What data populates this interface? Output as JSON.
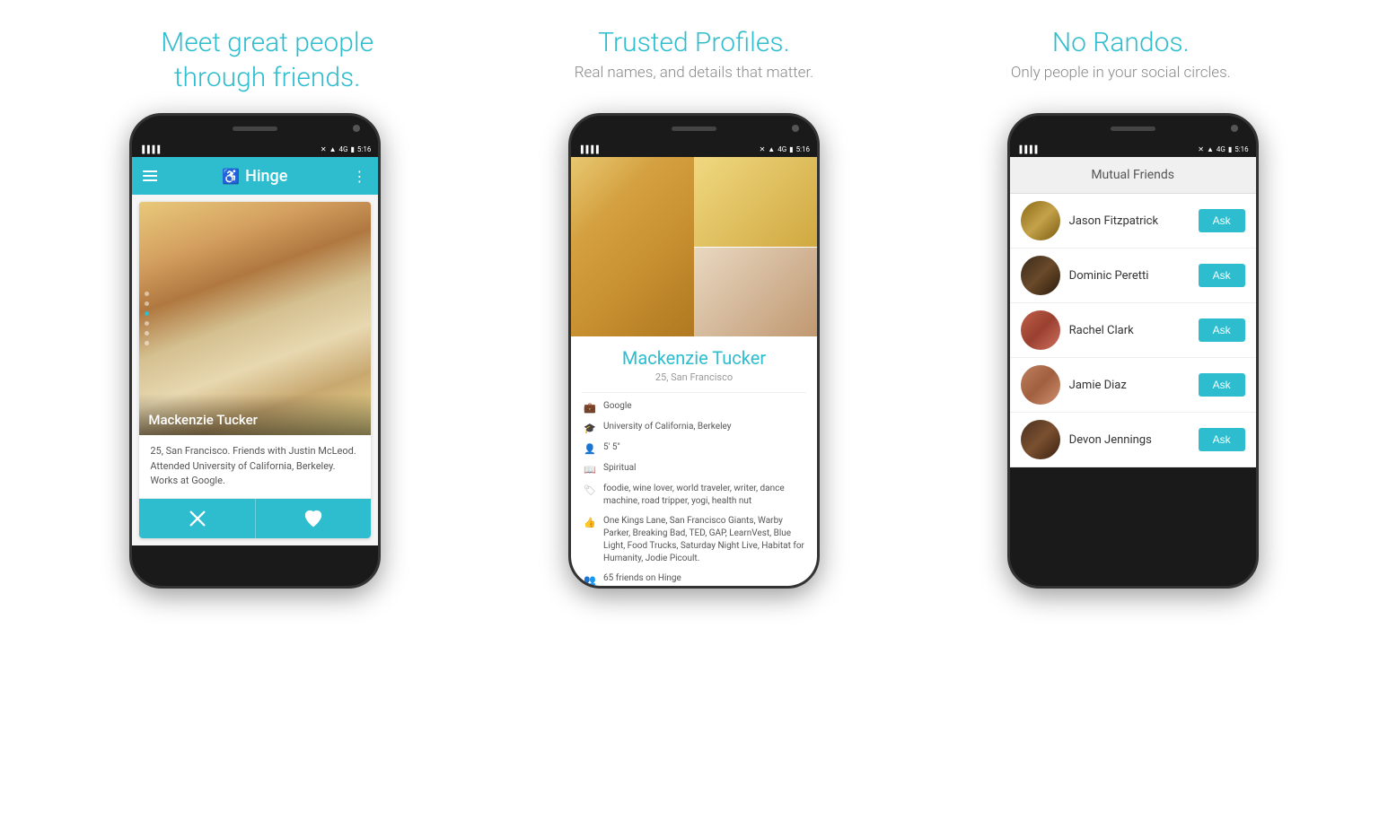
{
  "features": [
    {
      "id": "meet-friends",
      "heading_line1": "Meet great people",
      "heading_line2": "through friends.",
      "subtext": ""
    },
    {
      "id": "trusted-profiles",
      "heading_line1": "Trusted Profiles.",
      "heading_line2": "",
      "subtext": "Real names, and details that matter."
    },
    {
      "id": "no-randos",
      "heading_line1": "No Randos.",
      "heading_line2": "",
      "subtext": "Only people in your social circles."
    }
  ],
  "phone1": {
    "status_time": "5:16",
    "app_name": "Hinge",
    "profile": {
      "name": "Mackenzie Tucker",
      "description": "25, San Francisco. Friends with Justin McLeod. Attended University of California, Berkeley. Works at Google."
    },
    "pass_label": "Pass",
    "like_label": "Like"
  },
  "phone2": {
    "status_time": "5:16",
    "profile": {
      "name": "Mackenzie Tucker",
      "age_location": "25, San Francisco",
      "details": [
        {
          "icon": "briefcase",
          "text": "Google"
        },
        {
          "icon": "graduation",
          "text": "University of California, Berkeley"
        },
        {
          "icon": "height",
          "text": "5' 5\""
        },
        {
          "icon": "book",
          "text": "Spiritual"
        },
        {
          "icon": "tag",
          "text": "foodie, wine lover, world traveler, writer, dance machine, road tripper, yogi, health nut"
        },
        {
          "icon": "thumbs-up",
          "text": "One Kings Lane, San Francisco Giants, Warby Parker, Breaking Bad, TED, GAP, LearnVest, Blue Light, Food Trucks, Saturday Night Live, Habitat for Humanity, Jodie Picoult."
        },
        {
          "icon": "people",
          "text": "65 friends on Hinge"
        }
      ]
    }
  },
  "phone3": {
    "status_time": "5:16",
    "header": "Mutual Friends",
    "friends": [
      {
        "id": 1,
        "name": "Jason Fitzpatrick",
        "ask_label": "Ask"
      },
      {
        "id": 2,
        "name": "Dominic Peretti",
        "ask_label": "Ask"
      },
      {
        "id": 3,
        "name": "Rachel Clark",
        "ask_label": "Ask"
      },
      {
        "id": 4,
        "name": "Jamie Diaz",
        "ask_label": "Ask"
      },
      {
        "id": 5,
        "name": "Devon Jennings",
        "ask_label": "Ask"
      }
    ]
  },
  "colors": {
    "primary": "#2dbdce",
    "dark": "#1a1a1a",
    "light_bg": "#f5f5f5"
  }
}
